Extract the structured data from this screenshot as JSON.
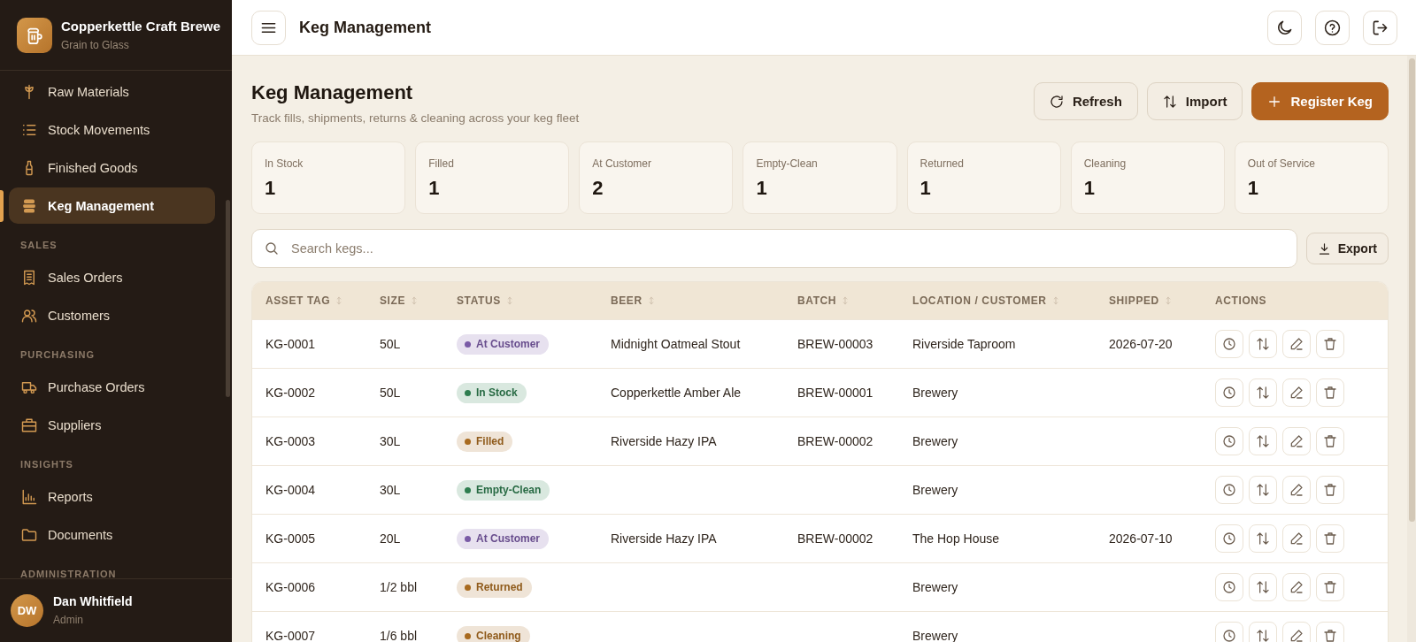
{
  "sidebar": {
    "brand": {
      "name": "Copperkettle Craft Brewe",
      "tagline": "Grain to Glass"
    },
    "nav": [
      {
        "items": [
          {
            "label": "Raw Materials",
            "selected": false
          },
          {
            "label": "Stock Movements",
            "selected": false
          },
          {
            "label": "Finished Goods",
            "selected": false
          },
          {
            "label": "Keg Management",
            "selected": true
          }
        ]
      },
      {
        "heading": "SALES",
        "items": [
          {
            "label": "Sales Orders",
            "selected": false
          },
          {
            "label": "Customers",
            "selected": false
          }
        ]
      },
      {
        "heading": "PURCHASING",
        "items": [
          {
            "label": "Purchase Orders",
            "selected": false
          },
          {
            "label": "Suppliers",
            "selected": false
          }
        ]
      },
      {
        "heading": "INSIGHTS",
        "items": [
          {
            "label": "Reports",
            "selected": false
          },
          {
            "label": "Documents",
            "selected": false
          }
        ]
      },
      {
        "heading": "ADMINISTRATION"
      }
    ],
    "user": {
      "initials": "DW",
      "name": "Dan Whitfield",
      "role": "Admin"
    }
  },
  "topbar": {
    "title": "Keg Management"
  },
  "page": {
    "title": "Keg Management",
    "subtitle": "Track fills, shipments, returns & cleaning across your keg fleet",
    "buttons": [
      {
        "label": "Refresh",
        "kind": "secondary"
      },
      {
        "label": "Import",
        "kind": "secondary"
      },
      {
        "label": "Register Keg",
        "kind": "primary"
      }
    ]
  },
  "stats": [
    {
      "label": "In Stock",
      "value": "1"
    },
    {
      "label": "Filled",
      "value": "1"
    },
    {
      "label": "At Customer",
      "value": "2"
    },
    {
      "label": "Empty-Clean",
      "value": "1"
    },
    {
      "label": "Returned",
      "value": "1"
    },
    {
      "label": "Cleaning",
      "value": "1"
    },
    {
      "label": "Out of Service",
      "value": "1"
    }
  ],
  "search": {
    "placeholder": "Search kegs..."
  },
  "export_button": {
    "label": "Export"
  },
  "table": {
    "columns": [
      {
        "label": "ASSET TAG",
        "sortable": true
      },
      {
        "label": "SIZE",
        "sortable": true
      },
      {
        "label": "STATUS",
        "sortable": true
      },
      {
        "label": "BEER",
        "sortable": true
      },
      {
        "label": "BATCH",
        "sortable": true
      },
      {
        "label": "LOCATION / CUSTOMER",
        "sortable": true
      },
      {
        "label": "SHIPPED",
        "sortable": true
      },
      {
        "label": "ACTIONS",
        "sortable": false
      }
    ],
    "rows": [
      {
        "asset_tag": "KG-0001",
        "size": "50L",
        "status": {
          "label": "At Customer",
          "color": "#7a5ba6"
        },
        "beer": "Midnight Oatmeal Stout",
        "batch": "BREW-00003",
        "location": "Riverside Taproom",
        "shipped": "2026-07-20"
      },
      {
        "asset_tag": "KG-0002",
        "size": "50L",
        "status": {
          "label": "In Stock",
          "color": "#2e7d4f"
        },
        "beer": "Copperkettle Amber Ale",
        "batch": "BREW-00001",
        "location": "Brewery"
      },
      {
        "asset_tag": "KG-0003",
        "size": "30L",
        "status": {
          "label": "Filled",
          "color": "#a86a1f"
        },
        "beer": "Riverside Hazy IPA",
        "batch": "BREW-00002",
        "location": "Brewery"
      },
      {
        "asset_tag": "KG-0004",
        "size": "30L",
        "status": {
          "label": "Empty-Clean",
          "color": "#2e7d4f"
        },
        "location": "Brewery"
      },
      {
        "asset_tag": "KG-0005",
        "size": "20L",
        "status": {
          "label": "At Customer",
          "color": "#7a5ba6"
        },
        "beer": "Riverside Hazy IPA",
        "batch": "BREW-00002",
        "location": "The Hop House",
        "shipped": "2026-07-10"
      },
      {
        "asset_tag": "KG-0006",
        "size": "1/2 bbl",
        "status": {
          "label": "Returned",
          "color": "#a86a1f"
        },
        "location": "Brewery"
      },
      {
        "asset_tag": "KG-0007",
        "size": "1/6 bbl",
        "status": {
          "label": "Cleaning",
          "color": "#a86a1f"
        },
        "location": "Brewery"
      }
    ]
  }
}
